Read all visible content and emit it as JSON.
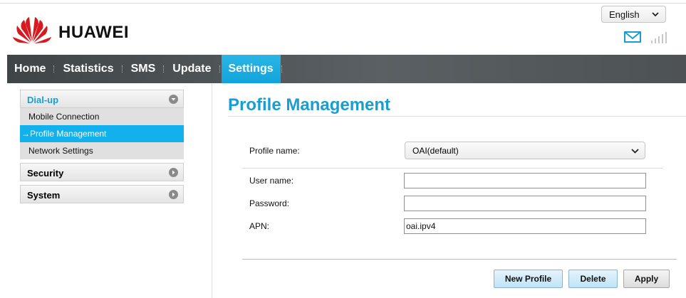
{
  "header": {
    "brand": "HUAWEI",
    "language": "English",
    "accent": "#12b0ec"
  },
  "nav": {
    "items": [
      {
        "label": "Home"
      },
      {
        "label": "Statistics"
      },
      {
        "label": "SMS"
      },
      {
        "label": "Update"
      },
      {
        "label": "Settings",
        "active": true
      }
    ]
  },
  "sidebar": {
    "groups": [
      {
        "label": "Dial-up",
        "expanded": true,
        "items": [
          {
            "label": "Mobile Connection"
          },
          {
            "label": "→Profile Management",
            "active": true
          },
          {
            "label": "Network Settings"
          }
        ]
      },
      {
        "label": "Security",
        "expanded": false
      },
      {
        "label": "System",
        "expanded": false
      }
    ]
  },
  "main": {
    "title": "Profile Management",
    "form": {
      "profile_name_label": "Profile name:",
      "profile_name_value": "OAI(default)",
      "user_name_label": "User name:",
      "user_name_value": "",
      "password_label": "Password:",
      "password_value": "",
      "apn_label": "APN:",
      "apn_value": "oai.ipv4"
    },
    "buttons": {
      "new_profile": "New Profile",
      "delete": "Delete",
      "apply": "Apply"
    }
  }
}
